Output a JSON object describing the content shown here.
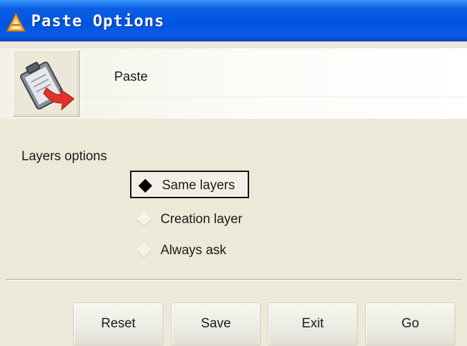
{
  "window": {
    "title": "Paste Options",
    "icon": "app-triangle-icon"
  },
  "header": {
    "title": "Paste",
    "icon": "clipboard-paste-icon"
  },
  "layers": {
    "label": "Layers options",
    "selected": "Same layers",
    "options": [
      {
        "label": "Same layers",
        "selected": true
      },
      {
        "label": "Creation layer",
        "selected": false
      },
      {
        "label": "Always ask",
        "selected": false
      }
    ]
  },
  "buttons": {
    "reset": "Reset",
    "save": "Save",
    "exit": "Exit",
    "go": "Go"
  },
  "colors": {
    "titlebar": "#0054e3",
    "background": "#ece9d8",
    "accent_red": "#e0342b"
  }
}
